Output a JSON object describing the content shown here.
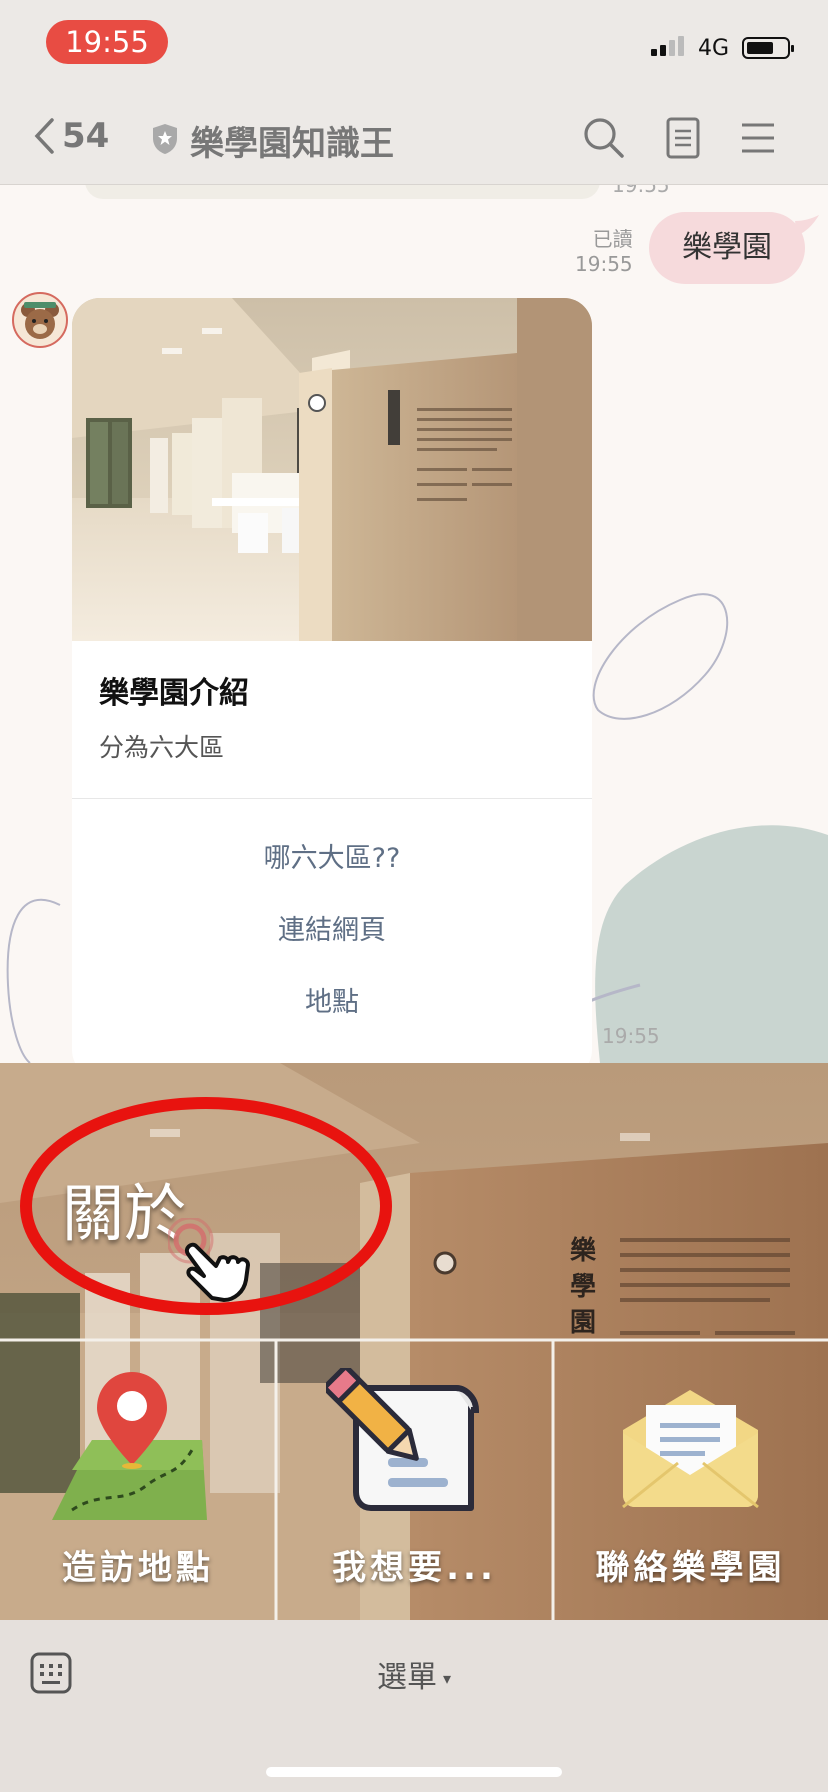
{
  "status_bar": {
    "time": "19:55",
    "network": "4G"
  },
  "header": {
    "back_count": "54",
    "title": "樂學園知識王"
  },
  "chat": {
    "prev_time": "19:55",
    "my_message": {
      "text": "樂學園",
      "read_label": "已讀",
      "time": "19:55"
    },
    "card": {
      "title": "樂學園介紹",
      "description": "分為六大區",
      "actions": [
        "哪六大區??",
        "連結網頁",
        "地點"
      ],
      "time": "19:55",
      "photo_sign": "樂學園"
    }
  },
  "rich_menu": {
    "about_label": "關於",
    "sign_text": "樂學園",
    "items": [
      {
        "label": "造訪地點",
        "icon": "map-pin-icon"
      },
      {
        "label": "我想要...",
        "icon": "pencil-note-icon"
      },
      {
        "label": "聯絡樂學園",
        "icon": "envelope-icon"
      }
    ]
  },
  "bottom_bar": {
    "menu_label": "選單"
  },
  "colors": {
    "status_pill": "#e84c43",
    "my_bubble": "#f6dadc",
    "action_text": "#5f6f85",
    "highlight_ring": "#e8130f"
  }
}
